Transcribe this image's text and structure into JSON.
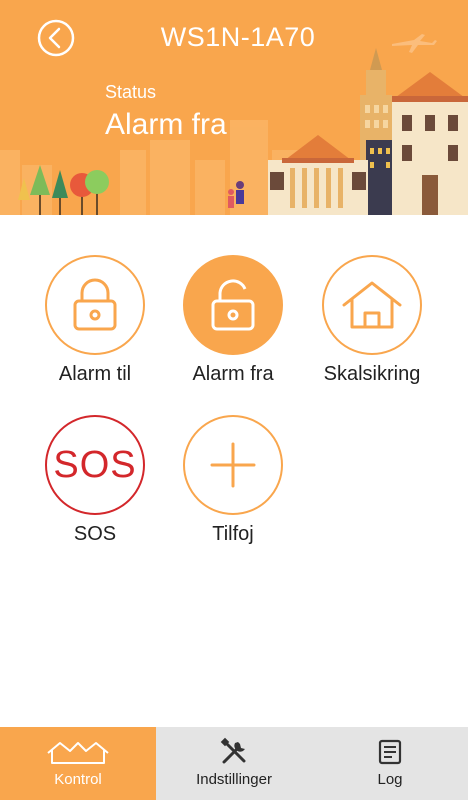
{
  "header": {
    "device_name": "WS1N-1A70",
    "status_label": "Status",
    "status_value": "Alarm fra",
    "back_icon": "chevron-left-icon"
  },
  "controls": [
    {
      "label": "Alarm til",
      "icon": "lock-closed-icon",
      "active": false
    },
    {
      "label": "Alarm fra",
      "icon": "lock-open-icon",
      "active": true
    },
    {
      "label": "Skalsikring",
      "icon": "house-icon",
      "active": false
    },
    {
      "label": "SOS",
      "icon_text": "SOS",
      "icon": "sos-icon",
      "active": false
    },
    {
      "label": "Tilfoj",
      "icon": "plus-icon",
      "active": false
    }
  ],
  "bottom_nav": [
    {
      "label": "Kontrol",
      "icon": "houses-icon",
      "active": true
    },
    {
      "label": "Indstillinger",
      "icon": "tools-icon",
      "active": false
    },
    {
      "label": "Log",
      "icon": "log-icon",
      "active": false
    }
  ],
  "colors": {
    "accent": "#f9a64d",
    "sos": "#d3272b",
    "nav_background": "#e4e4e4"
  }
}
